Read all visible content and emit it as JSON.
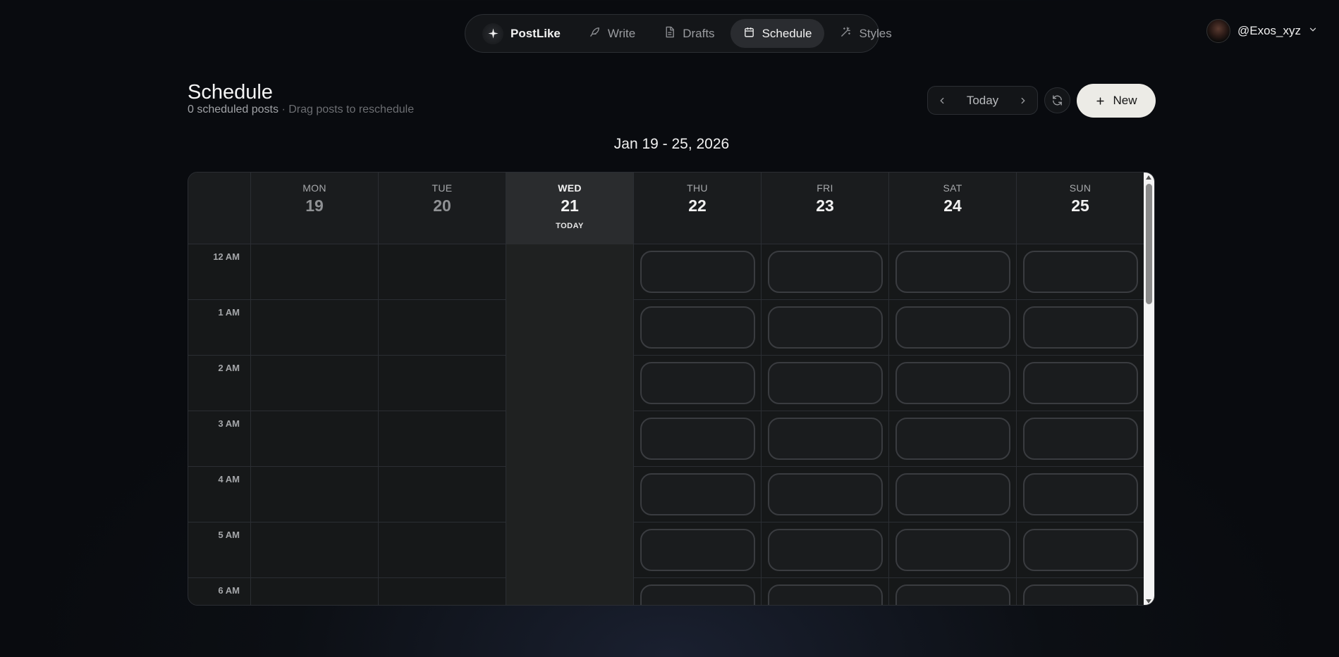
{
  "nav": {
    "brand": "PostLike",
    "items": [
      {
        "label": "Write",
        "icon": "feather-icon"
      },
      {
        "label": "Drafts",
        "icon": "document-icon"
      },
      {
        "label": "Schedule",
        "icon": "calendar-icon",
        "active": true
      },
      {
        "label": "Styles",
        "icon": "magic-wand-icon"
      }
    ]
  },
  "user": {
    "handle": "@Exos_xyz"
  },
  "header": {
    "title": "Schedule",
    "count_text": "0 scheduled posts",
    "hint_text": "· Drag posts to reschedule",
    "today_label": "Today",
    "new_label": "New"
  },
  "calendar": {
    "range": "Jan 19 - 25, 2026",
    "today_tag": "TODAY",
    "days": [
      {
        "dow": "MON",
        "num": "19",
        "state": "past"
      },
      {
        "dow": "TUE",
        "num": "20",
        "state": "past"
      },
      {
        "dow": "WED",
        "num": "21",
        "state": "today"
      },
      {
        "dow": "THU",
        "num": "22",
        "state": "future"
      },
      {
        "dow": "FRI",
        "num": "23",
        "state": "future"
      },
      {
        "dow": "SAT",
        "num": "24",
        "state": "future"
      },
      {
        "dow": "SUN",
        "num": "25",
        "state": "future"
      }
    ],
    "hours": [
      "12 AM",
      "1 AM",
      "2 AM",
      "3 AM",
      "4 AM",
      "5 AM",
      "6 AM"
    ]
  },
  "colors": {
    "accent_button": "#ecebe6",
    "background": "#0c0f14",
    "today_column": "#2a2c2e"
  }
}
